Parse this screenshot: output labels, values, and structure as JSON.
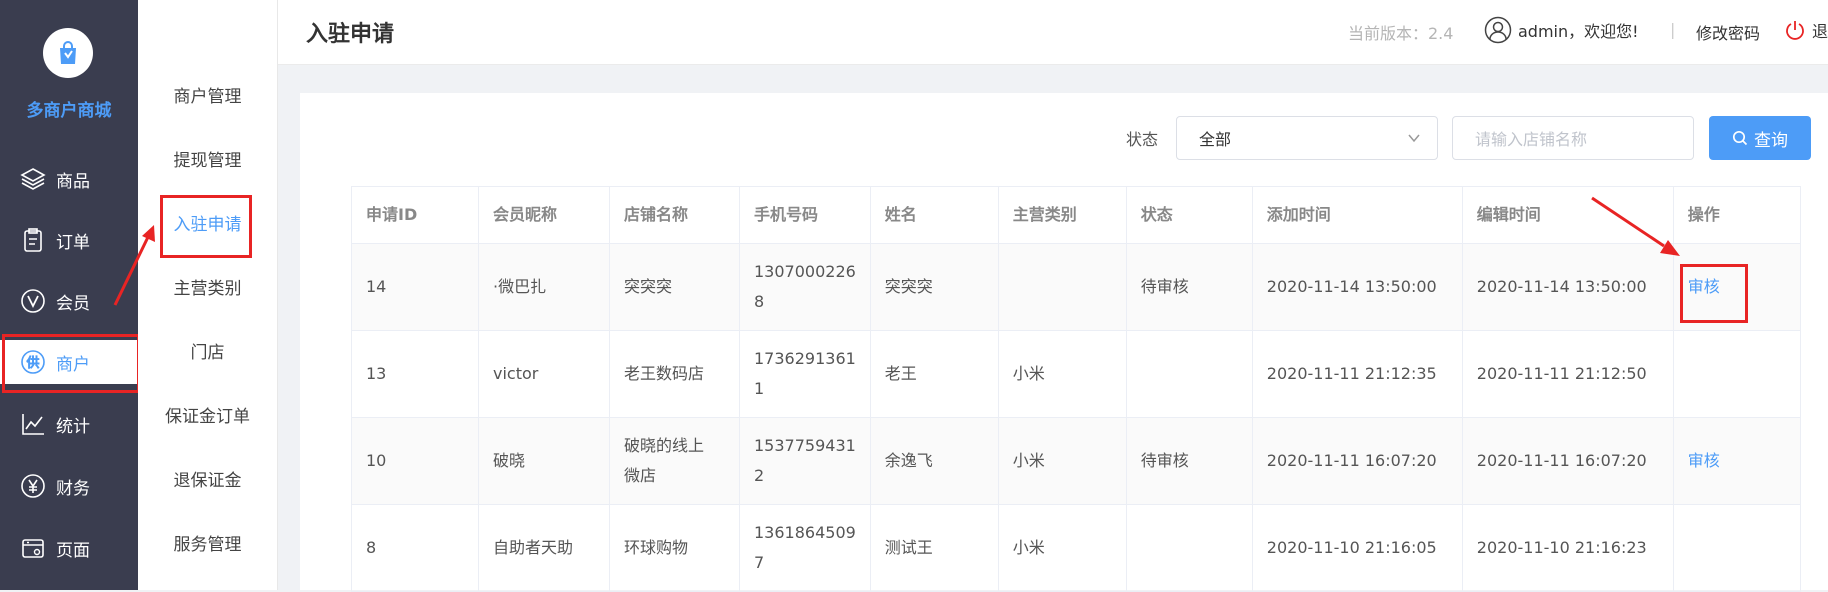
{
  "app": {
    "brand": "多商户商城"
  },
  "sidebar": {
    "items": [
      {
        "label": "商品",
        "icon": "layers-icon"
      },
      {
        "label": "订单",
        "icon": "clipboard-icon"
      },
      {
        "label": "会员",
        "icon": "v-badge-icon"
      },
      {
        "label": "商户",
        "icon": "supply-badge-icon",
        "active": true
      },
      {
        "label": "统计",
        "icon": "chart-line-icon"
      },
      {
        "label": "财务",
        "icon": "yen-icon"
      },
      {
        "label": "页面",
        "icon": "page-icon"
      }
    ]
  },
  "subnav": {
    "items": [
      {
        "label": "商户管理"
      },
      {
        "label": "提现管理"
      },
      {
        "label": "入驻申请",
        "active": true
      },
      {
        "label": "主营类别"
      },
      {
        "label": "门店"
      },
      {
        "label": "保证金订单"
      },
      {
        "label": "退保证金"
      },
      {
        "label": "服务管理"
      }
    ]
  },
  "header": {
    "title": "入驻申请",
    "version": "当前版本：2.4",
    "user": "admin，欢迎您!",
    "separator": "|",
    "change_password": "修改密码",
    "logout": "退"
  },
  "filters": {
    "status_label": "状态",
    "status_value": "全部",
    "search_placeholder": "请输入店铺名称",
    "query_label": "查询"
  },
  "table": {
    "columns": [
      "申请ID",
      "会员昵称",
      "店铺名称",
      "手机号码",
      "姓名",
      "主营类别",
      "状态",
      "添加时间",
      "编辑时间",
      "操作"
    ],
    "rows": [
      {
        "id": "14",
        "nickname": "·微巴扎",
        "shop_line1": "突突突",
        "shop_line2": "",
        "phone_line1": "1307000226",
        "phone_line2": "8",
        "name": "突突突",
        "category": "",
        "status": "待审核",
        "added": "2020-11-14 13:50:00",
        "edited": "2020-11-14 13:50:00",
        "action": "审核"
      },
      {
        "id": "13",
        "nickname": "victor",
        "shop_line1": "老王数码店",
        "shop_line2": "",
        "phone_line1": "1736291361",
        "phone_line2": "1",
        "name": "老王",
        "category": "小米",
        "status": "",
        "added": "2020-11-11 21:12:35",
        "edited": "2020-11-11 21:12:50",
        "action": ""
      },
      {
        "id": "10",
        "nickname": "破晓",
        "shop_line1": "破晓的线上",
        "shop_line2": "微店",
        "phone_line1": "1537759431",
        "phone_line2": "2",
        "name": "余逸飞",
        "category": "小米",
        "status": "待审核",
        "added": "2020-11-11 16:07:20",
        "edited": "2020-11-11 16:07:20",
        "action": "审核"
      },
      {
        "id": "8",
        "nickname": "自助者天助",
        "shop_line1": "环球购物",
        "shop_line2": "",
        "phone_line1": "1361864509",
        "phone_line2": "7",
        "name": "测试王",
        "category": "小米",
        "status": "",
        "added": "2020-11-10 21:16:05",
        "edited": "2020-11-10 21:16:23",
        "action": ""
      }
    ]
  },
  "colors": {
    "accent": "#4d9cf7",
    "sidebar_bg": "#3a3d4f",
    "annotation": "#e82424"
  }
}
